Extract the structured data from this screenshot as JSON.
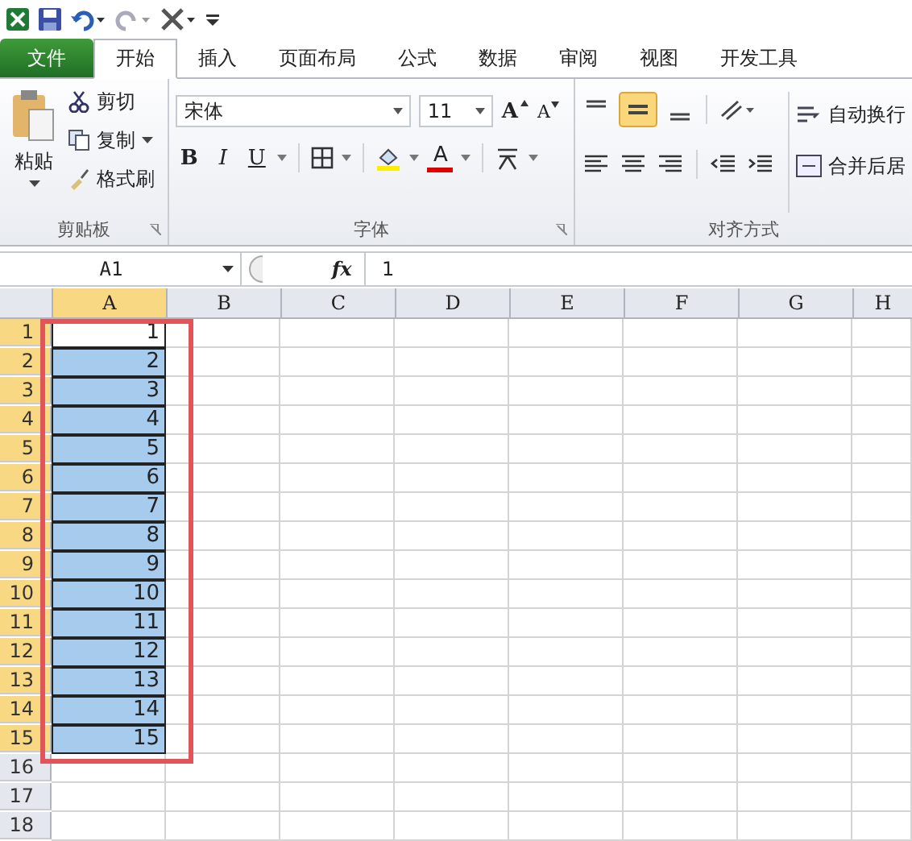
{
  "tabs": [
    {
      "label": "文件",
      "kind": "file",
      "selected": false
    },
    {
      "label": "开始",
      "kind": "tab",
      "selected": true
    },
    {
      "label": "插入",
      "kind": "tab",
      "selected": false
    },
    {
      "label": "页面布局",
      "kind": "tab",
      "selected": false
    },
    {
      "label": "公式",
      "kind": "tab",
      "selected": false
    },
    {
      "label": "数据",
      "kind": "tab",
      "selected": false
    },
    {
      "label": "审阅",
      "kind": "tab",
      "selected": false
    },
    {
      "label": "视图",
      "kind": "tab",
      "selected": false
    },
    {
      "label": "开发工具",
      "kind": "tab",
      "selected": false
    }
  ],
  "clipboard": {
    "paste": "粘贴",
    "cut": "剪切",
    "copy": "复制",
    "format_painter": "格式刷",
    "label": "剪贴板"
  },
  "font": {
    "name": "宋体",
    "size": "11",
    "grow": "A",
    "shrink": "A",
    "bold": "B",
    "italic": "I",
    "underline": "U",
    "color_button": "A",
    "label": "字体"
  },
  "alignment": {
    "middle_align_selected": true,
    "wrap_text": "自动换行",
    "merge_center": "合并后居",
    "label": "对齐方式"
  },
  "formula_bar": {
    "name_box": "A1",
    "fx": "fx",
    "value": "1"
  },
  "sheet": {
    "columns": [
      {
        "label": "A",
        "selected": true
      },
      {
        "label": "B",
        "selected": false
      },
      {
        "label": "C",
        "selected": false
      },
      {
        "label": "D",
        "selected": false
      },
      {
        "label": "E",
        "selected": false
      },
      {
        "label": "F",
        "selected": false
      },
      {
        "label": "G",
        "selected": false
      },
      {
        "label": "H",
        "selected": false
      }
    ],
    "rows": [
      {
        "number": "1",
        "selected": true,
        "active": true,
        "value": "1"
      },
      {
        "number": "2",
        "selected": true,
        "active": false,
        "value": "2"
      },
      {
        "number": "3",
        "selected": true,
        "active": false,
        "value": "3"
      },
      {
        "number": "4",
        "selected": true,
        "active": false,
        "value": "4"
      },
      {
        "number": "5",
        "selected": true,
        "active": false,
        "value": "5"
      },
      {
        "number": "6",
        "selected": true,
        "active": false,
        "value": "6"
      },
      {
        "number": "7",
        "selected": true,
        "active": false,
        "value": "7"
      },
      {
        "number": "8",
        "selected": true,
        "active": false,
        "value": "8"
      },
      {
        "number": "9",
        "selected": true,
        "active": false,
        "value": "9"
      },
      {
        "number": "10",
        "selected": true,
        "active": false,
        "value": "10"
      },
      {
        "number": "11",
        "selected": true,
        "active": false,
        "value": "11"
      },
      {
        "number": "12",
        "selected": true,
        "active": false,
        "value": "12"
      },
      {
        "number": "13",
        "selected": true,
        "active": false,
        "value": "13"
      },
      {
        "number": "14",
        "selected": true,
        "active": false,
        "value": "14"
      },
      {
        "number": "15",
        "selected": true,
        "active": false,
        "value": "15"
      },
      {
        "number": "16",
        "selected": false,
        "active": false,
        "value": ""
      },
      {
        "number": "17",
        "selected": false,
        "active": false,
        "value": ""
      },
      {
        "number": "18",
        "selected": false,
        "active": false,
        "value": ""
      }
    ]
  }
}
